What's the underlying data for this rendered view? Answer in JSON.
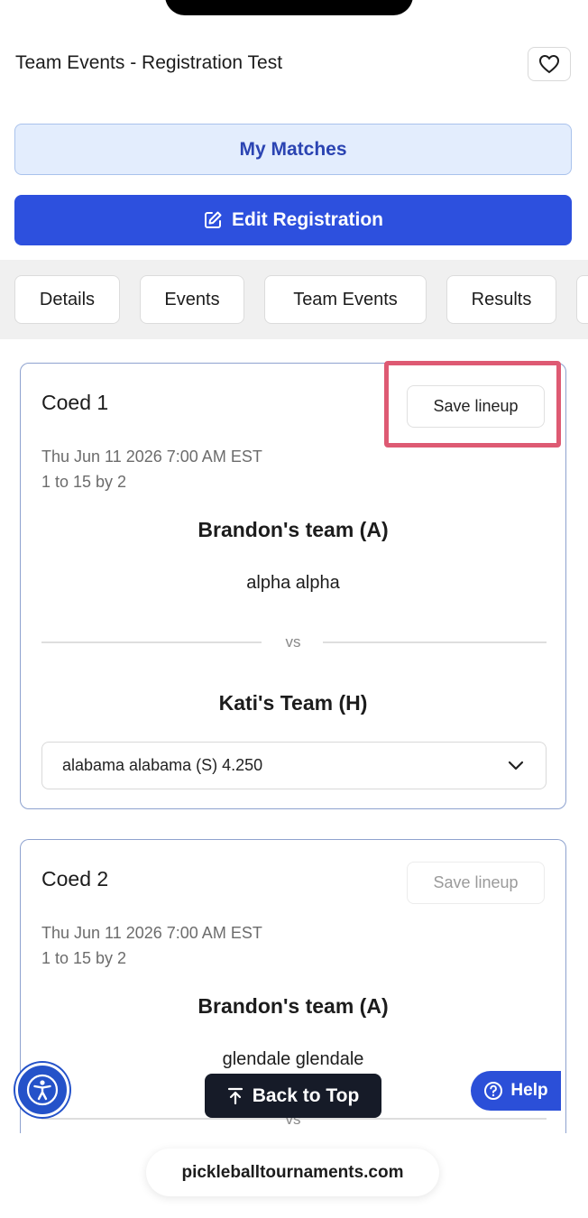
{
  "header": {
    "title": "Team Events - Registration Test",
    "favorite_icon": "heart-icon"
  },
  "actions": {
    "my_matches": "My Matches",
    "edit_registration": "Edit Registration",
    "edit_icon": "edit-icon"
  },
  "tabs": [
    {
      "label": "Details"
    },
    {
      "label": "Events"
    },
    {
      "label": "Team Events"
    },
    {
      "label": "Results"
    }
  ],
  "matches": [
    {
      "title": "Coed 1",
      "save_label": "Save lineup",
      "save_enabled": true,
      "date": "Thu Jun 11 2026 7:00 AM EST",
      "format": "1 to 15 by 2",
      "team_a": "Brandon's team (A)",
      "team_a_player": "alpha alpha",
      "vs": "vs",
      "team_h": "Kati's Team (H)",
      "team_h_select": "alabama alabama (S) 4.250"
    },
    {
      "title": "Coed 2",
      "save_label": "Save lineup",
      "save_enabled": false,
      "date": "Thu Jun 11 2026 7:00 AM EST",
      "format": "1 to 15 by 2",
      "team_a": "Brandon's team (A)",
      "team_a_player": "glendale glendale",
      "vs": "vs"
    }
  ],
  "floating": {
    "back_to_top": "Back to Top",
    "help": "Help"
  },
  "browser": {
    "url": "pickleballtournaments.com"
  },
  "colors": {
    "primary": "#2d50de",
    "highlight": "#de5a73",
    "light_blue": "#e3edfd"
  }
}
